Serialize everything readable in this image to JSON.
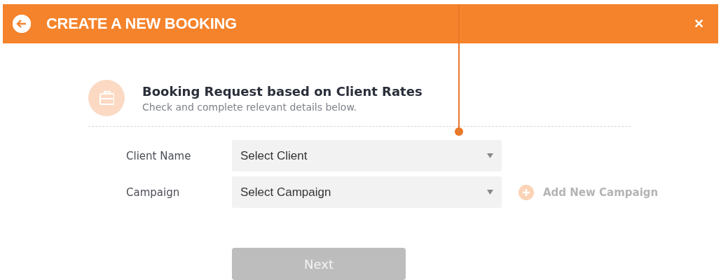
{
  "header": {
    "title": "CREATE A NEW BOOKING",
    "close_glyph": "✕"
  },
  "intro": {
    "heading": "Booking Request based on Client Rates",
    "subheading": "Check and complete relevant details below."
  },
  "fields": [
    {
      "label": "Client Name",
      "value": "Select Client"
    },
    {
      "label": "Campaign",
      "value": "Select Campaign",
      "action": {
        "label": "Add New Campaign",
        "disabled": true
      }
    }
  ],
  "next_button": {
    "label": "Next",
    "disabled": true
  }
}
